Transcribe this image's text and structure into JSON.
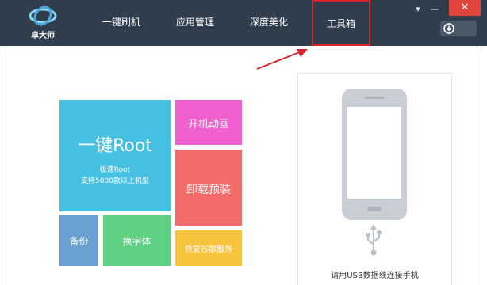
{
  "app": {
    "logo_text": "卓大师"
  },
  "nav": {
    "items": [
      {
        "label": "一键刷机"
      },
      {
        "label": "应用管理"
      },
      {
        "label": "深度美化"
      },
      {
        "label": "工具箱"
      }
    ],
    "active_index": 3
  },
  "window_controls": {
    "menu": "▾",
    "minimize": "—",
    "close": "✕"
  },
  "tiles": {
    "root": {
      "title": "一键Root",
      "line1": "极速Root",
      "line2": "支持5000款以上机型"
    },
    "boot_animation": {
      "label": "开机动画"
    },
    "uninstall_preinstalled": {
      "label": "卸载预装"
    },
    "backup": {
      "label": "备份"
    },
    "change_font": {
      "label": "换字体"
    },
    "restore_google": {
      "label": "恢复谷歌服务"
    }
  },
  "device": {
    "connect_prompt": "请用USB数据线连接手机"
  },
  "colors": {
    "header_bg": "#2f3d4c",
    "highlight_border": "#d9232a",
    "arrow": "#d9232a",
    "root_tile": "#46c1e4",
    "boot_tile": "#f160cf",
    "uninstall_tile": "#f26d6a",
    "backup_tile": "#6a9fd1",
    "font_tile": "#60d083",
    "google_tile": "#f8c43e"
  }
}
